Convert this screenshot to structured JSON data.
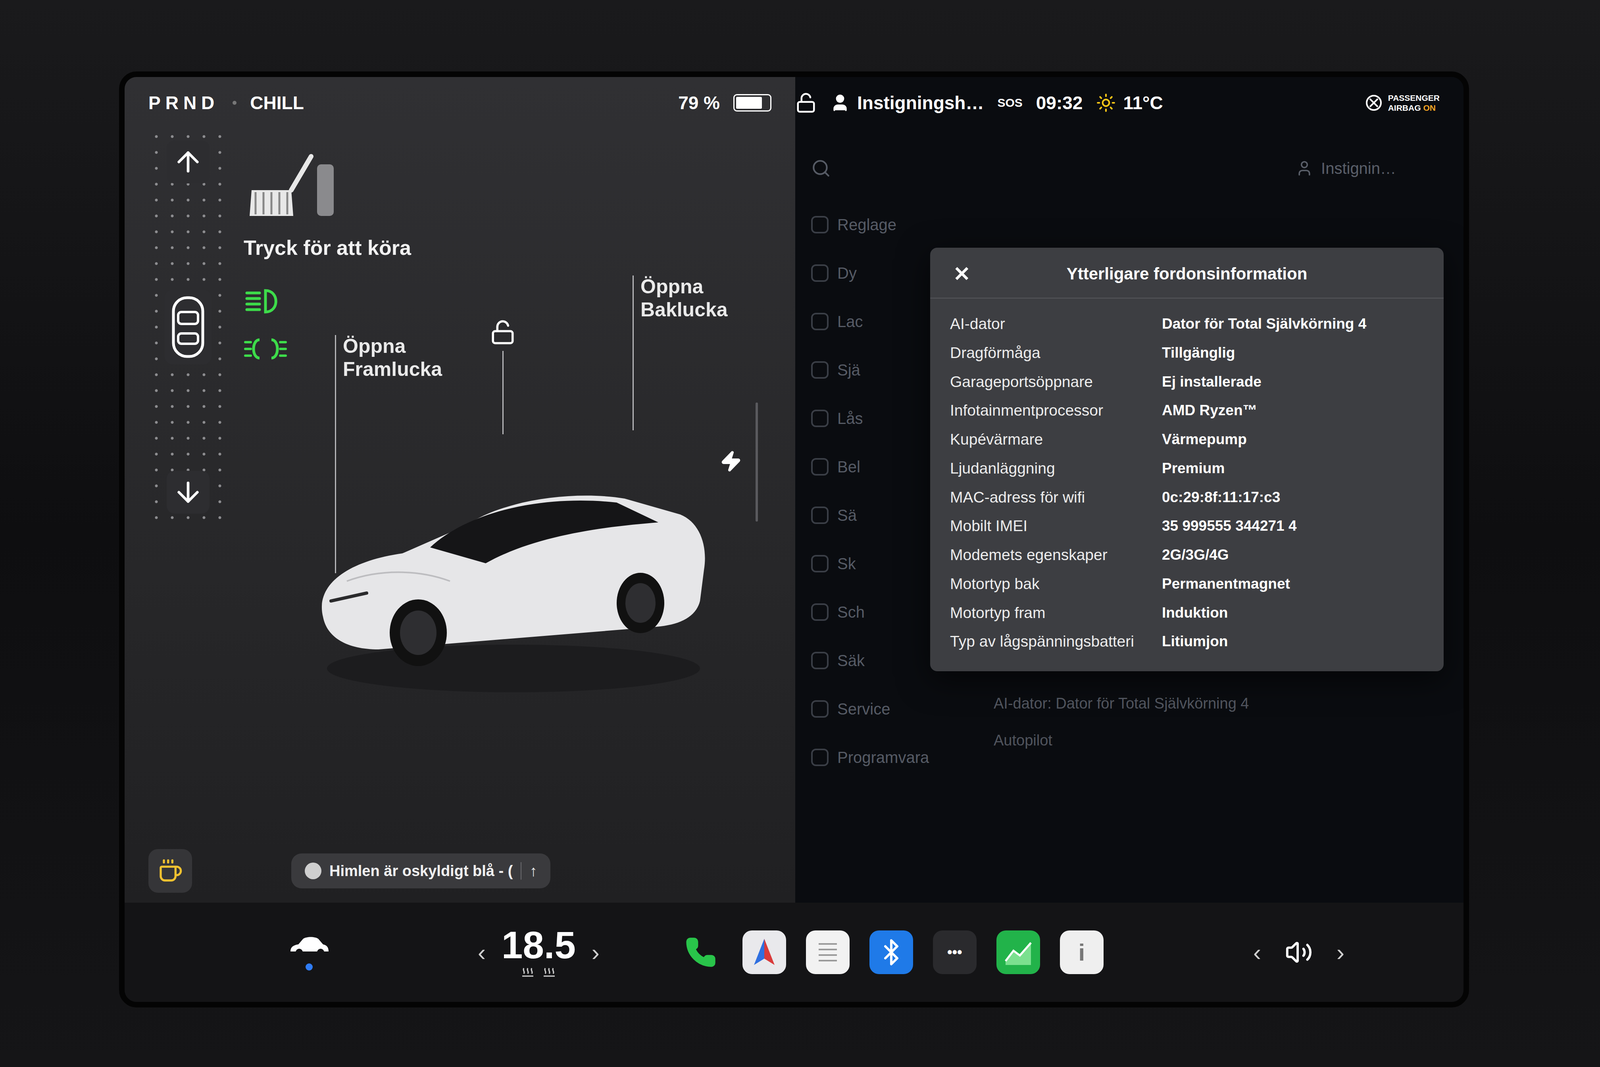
{
  "status_bar": {
    "gears": "PRND",
    "drive_mode": "CHILL",
    "battery": "79 %",
    "battery_level": 0.79,
    "profile": "Instigningsh…",
    "sos": "SOS",
    "time": "09:32",
    "temperature": "11°C",
    "airbag": {
      "lines": [
        "PASSENGER",
        "AIRBAG"
      ],
      "state": "ON"
    }
  },
  "drive": {
    "prompt": "Tryck för att köra",
    "headlights_on": true,
    "parking_lights_on": true
  },
  "car": {
    "frunk_label": [
      "Öppna",
      "Framlucka"
    ],
    "trunk_label": [
      "Öppna",
      "Baklucka"
    ],
    "locked": false
  },
  "media": {
    "title": "Himlen är oskyldigt blå - (",
    "expand": "↑"
  },
  "climate": {
    "temperature": "18.5",
    "decrease": "‹",
    "increase": "›"
  },
  "bottom_car": {
    "selected": true
  },
  "settings_menu": {
    "profile": "Instignin…",
    "items": [
      "Reglage",
      "Dy",
      "Lac",
      "Sjä",
      "Lås",
      "Bel",
      "Sä",
      "Sk",
      "Sch",
      "Säk",
      "Service",
      "Programvara"
    ]
  },
  "background_detail": [
    "AI-dator: Dator för Total Självkörning 4",
    "Autopilot"
  ],
  "dialog": {
    "title": "Ytterligare fordonsinformation",
    "close": "✕",
    "rows": [
      {
        "label": "AI-dator",
        "value": "Dator för Total Självkörning 4"
      },
      {
        "label": "Dragförmåga",
        "value": "Tillgänglig"
      },
      {
        "label": "Garageportsöppnare",
        "value": "Ej installerade"
      },
      {
        "label": "Infotainmentprocessor",
        "value": "AMD Ryzen™"
      },
      {
        "label": "Kupévärmare",
        "value": "Värmepump"
      },
      {
        "label": "Ljudanläggning",
        "value": "Premium"
      },
      {
        "label": "MAC-adress för wifi",
        "value": "0c:29:8f:11:17:c3"
      },
      {
        "label": "Mobilt IMEI",
        "value": "35 999555 344271 4"
      },
      {
        "label": "Modemets egenskaper",
        "value": "2G/3G/4G"
      },
      {
        "label": "Motortyp bak",
        "value": "Permanentmagnet"
      },
      {
        "label": "Motortyp fram",
        "value": "Induktion"
      },
      {
        "label": "Typ av lågspänningsbatteri",
        "value": "Litiumjon"
      }
    ]
  },
  "dock": {
    "apps": [
      {
        "kind": "phone"
      },
      {
        "kind": "navigation"
      },
      {
        "kind": "notes"
      },
      {
        "kind": "bluetooth"
      },
      {
        "kind": "more",
        "label": "•••"
      },
      {
        "kind": "energy"
      },
      {
        "kind": "manual",
        "label": "i"
      }
    ]
  },
  "volume": {
    "prev": "‹",
    "next": "›"
  }
}
